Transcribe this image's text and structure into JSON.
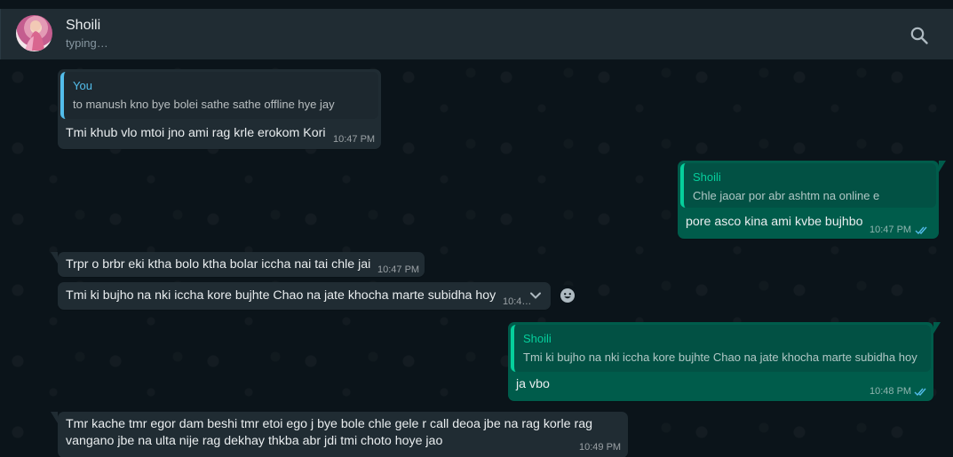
{
  "header": {
    "contact_name": "Shoili",
    "status": "typing…"
  },
  "messages": [
    {
      "direction": "in",
      "quote_author": "You",
      "quote_text": "to manush kno bye bolei sathe sathe offline hye jay",
      "text": "Tmi khub vlo mtoi jno ami rag krle erokom Kori",
      "time": "10:47 PM"
    },
    {
      "direction": "out",
      "quote_author": "Shoili",
      "quote_text": "Chle jaoar por abr ashtm na online e",
      "text": "pore asco kina ami kvbe bujhbo",
      "time": "10:47 PM",
      "status": "read"
    },
    {
      "direction": "in",
      "text": "Trpr o brbr eki ktha bolo ktha bolar iccha nai tai chle jai",
      "time": "10:47 PM"
    },
    {
      "direction": "in",
      "text": "Tmi ki bujho na nki iccha kore bujhte Chao na jate khocha marte subidha hoy",
      "time": "10:4…"
    },
    {
      "direction": "out",
      "quote_author": "Shoili",
      "quote_text": "Tmi ki bujho na nki iccha kore bujhte Chao na jate khocha marte subidha hoy",
      "text": "ja vbo",
      "time": "10:48 PM",
      "status": "read"
    },
    {
      "direction": "in",
      "text_line1": "Tmr kache tmr egor dam beshi tmr etoi ego j bye bole chle gele r call deoa jbe na rag korle rag",
      "text_line2": "vangano jbe na ulta nije rag dekhay thkba abr jdi tmi choto hoye jao",
      "time": "10:49 PM"
    }
  ],
  "icons": {
    "search": "search-icon",
    "menu": "chevron-down-icon",
    "react": "emoji-icon",
    "read_ticks": "double-check-icon"
  },
  "colors": {
    "incoming_bubble": "#202c33",
    "outgoing_bubble": "#005c4b",
    "read_tick": "#53bdeb",
    "quote_you": "#53bdeb",
    "quote_contact": "#06cf9c"
  }
}
